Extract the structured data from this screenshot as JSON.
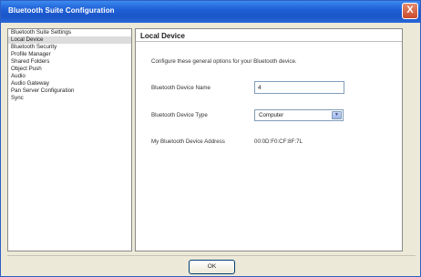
{
  "window": {
    "title": "Bluetooth Suite Configuration",
    "close_glyph": "X"
  },
  "sidebar": {
    "items": [
      {
        "label": "Bluetooth Suite Settings",
        "selected": false
      },
      {
        "label": "Local Device",
        "selected": true
      },
      {
        "label": "Bluetooth Security",
        "selected": false
      },
      {
        "label": "Profile Manager",
        "selected": false
      },
      {
        "label": "Shared Folders",
        "selected": false
      },
      {
        "label": "Object Push",
        "selected": false
      },
      {
        "label": "Audio",
        "selected": false
      },
      {
        "label": "Audio Gateway",
        "selected": false
      },
      {
        "label": "Pan Server Configuration",
        "selected": false
      },
      {
        "label": "Sync",
        "selected": false
      }
    ]
  },
  "main": {
    "title": "Local Device",
    "description": "Configure these general options for your Bluetooth device.",
    "device_name": {
      "label": "Bluetooth Device Name",
      "value": "4"
    },
    "device_type": {
      "label": "Bluetooth Device Type",
      "value": "Computer"
    },
    "address": {
      "label": "My Bluetooth Device Address",
      "value": "00:0D:F0:CF:8F:7L"
    }
  },
  "footer": {
    "ok_label": "OK"
  },
  "colors": {
    "titlebar": "#1e5fd6",
    "window_bg": "#ece9d8",
    "close_button": "#c94a2a"
  }
}
